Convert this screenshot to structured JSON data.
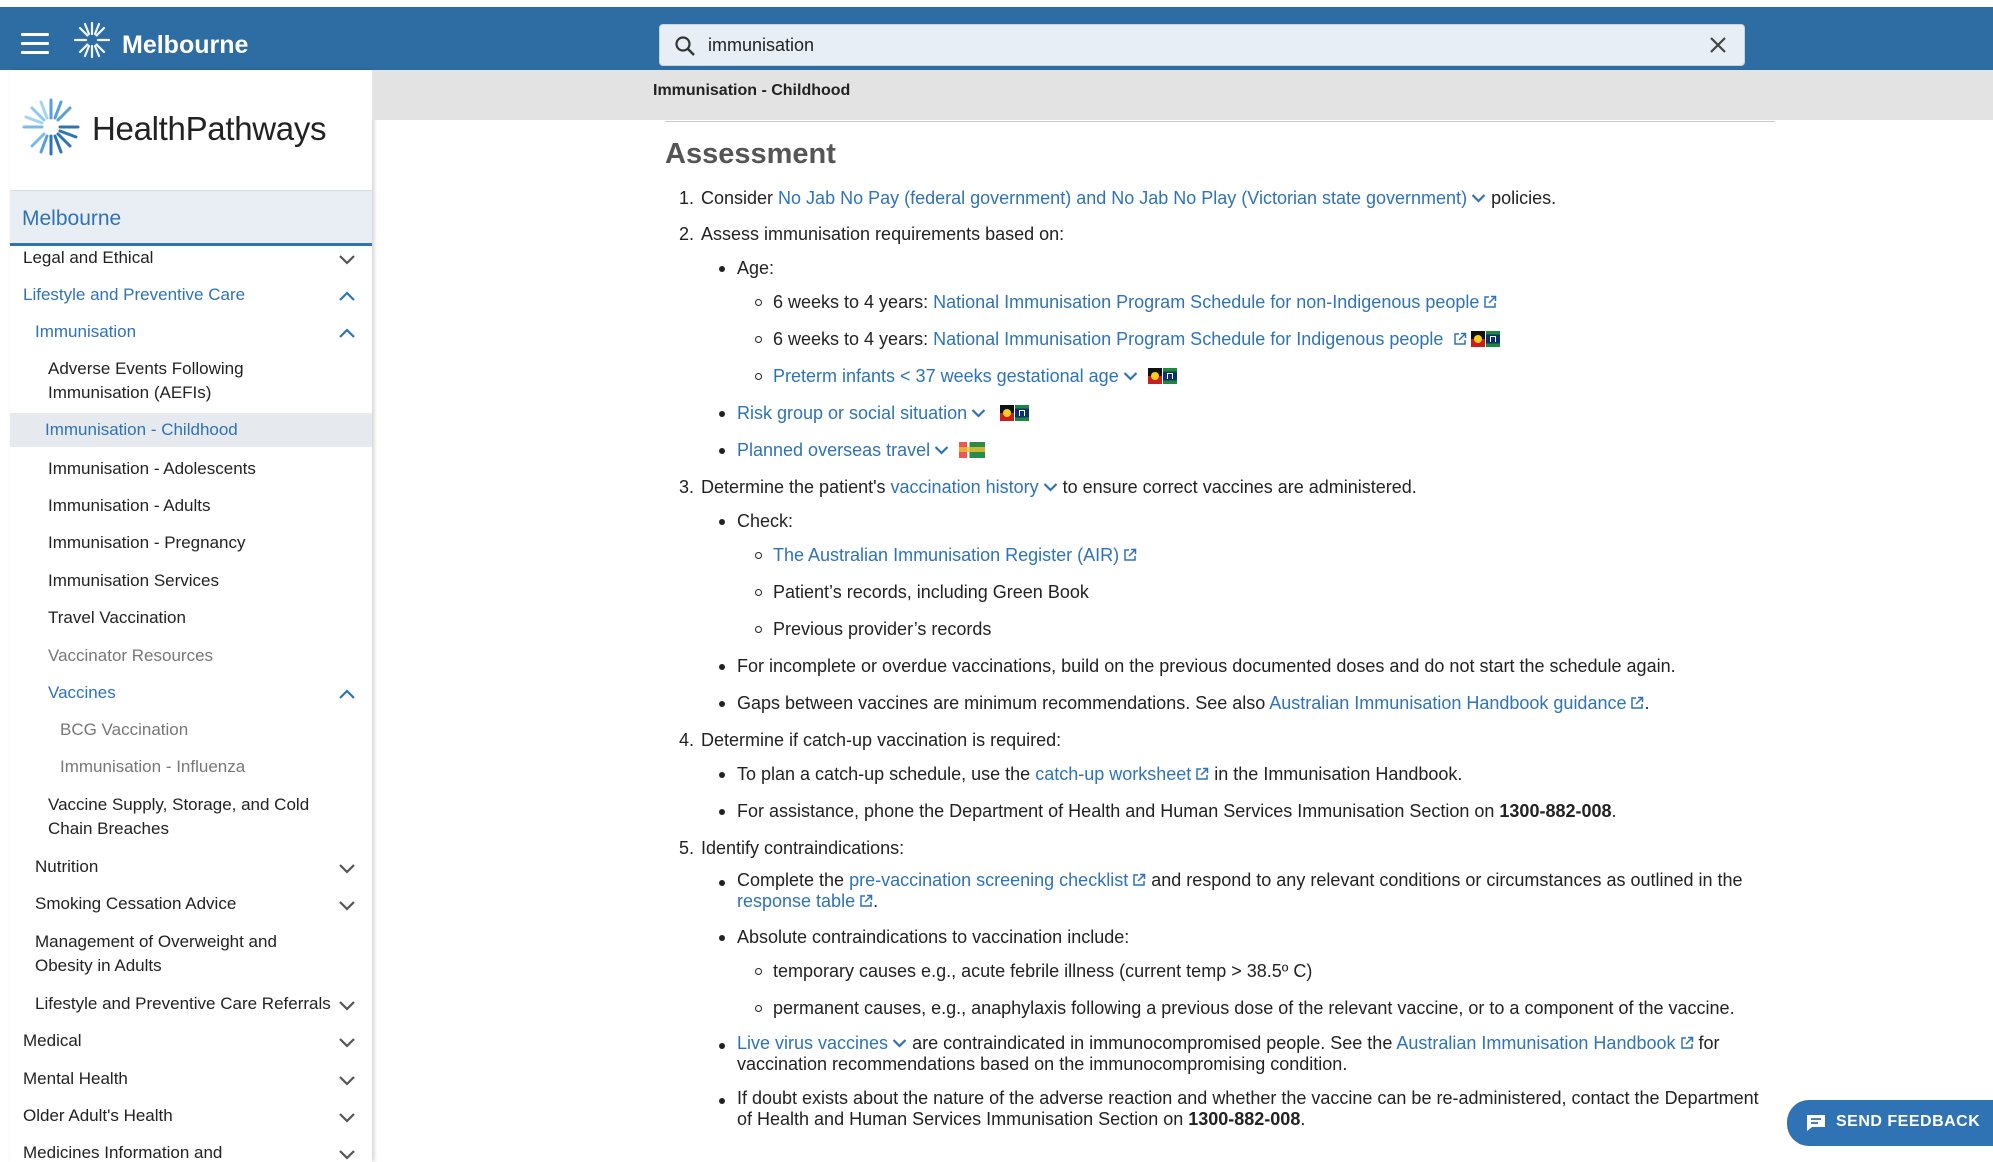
{
  "header": {
    "brand": "Melbourne",
    "search_value": "immunisation"
  },
  "sidebar": {
    "logo_text": "HealthPathways",
    "region": "Melbourne",
    "items": [
      {
        "label": "Legal and Ethical",
        "chevron": "down"
      },
      {
        "label": "Lifestyle and Preventive Care",
        "chevron": "up"
      },
      {
        "label": "Immunisation",
        "chevron": "up"
      },
      {
        "label": "Adverse Events Following Immunisation (AEFIs)"
      },
      {
        "label": "Immunisation - Childhood"
      },
      {
        "label": "Immunisation - Adolescents"
      },
      {
        "label": "Immunisation - Adults"
      },
      {
        "label": "Immunisation - Pregnancy"
      },
      {
        "label": "Immunisation Services"
      },
      {
        "label": "Travel Vaccination"
      },
      {
        "label": "Vaccinator Resources"
      },
      {
        "label": "Vaccines",
        "chevron": "up"
      },
      {
        "label": "BCG Vaccination"
      },
      {
        "label": "Immunisation - Influenza"
      },
      {
        "label": "Vaccine Supply, Storage, and Cold Chain Breaches"
      },
      {
        "label": "Nutrition",
        "chevron": "down"
      },
      {
        "label": "Smoking Cessation Advice",
        "chevron": "down"
      },
      {
        "label": "Management of Overweight and Obesity in Adults"
      },
      {
        "label": "Lifestyle and Preventive Care Referrals",
        "chevron": "down"
      },
      {
        "label": "Medical",
        "chevron": "down"
      },
      {
        "label": "Mental Health",
        "chevron": "down"
      },
      {
        "label": "Older Adult's Health",
        "chevron": "down"
      },
      {
        "label": "Medicines Information and Resources",
        "chevron": "down"
      }
    ]
  },
  "breadcrumb": "Immunisation - Childhood",
  "content": {
    "heading": "Assessment",
    "s1": {
      "num": "1.",
      "pre": "Consider ",
      "link": "No Jab No Pay (federal government) and No Jab No Play (Victorian state government)",
      "post": " policies."
    },
    "s2": {
      "num": "2.",
      "text": "Assess immunisation requirements based on:",
      "age": "Age:",
      "age_a_pre": "6 weeks to 4 years: ",
      "age_a_link": "National Immunisation Program Schedule for non-Indigenous people",
      "age_b_pre": "6 weeks to 4 years: ",
      "age_b_link": "National Immunisation Program Schedule for Indigenous people",
      "preterm": "Preterm infants < 37 weeks gestational age",
      "risk": "Risk group or social situation",
      "travel": "Planned overseas travel"
    },
    "s3": {
      "num": "3.",
      "pre": "Determine the patient's ",
      "link": "vaccination history",
      "post": " to ensure correct vaccines are administered.",
      "check": "Check:",
      "air": "The Australian Immunisation Register (AIR)",
      "records": "Patient’s records, including Green Book",
      "prev": "Previous provider’s records",
      "incomplete": "For incomplete or overdue vaccinations, build on the previous documented doses and do not start the schedule again.",
      "gaps_pre": "Gaps between vaccines are minimum recommendations. See also ",
      "gaps_link": "Australian Immunisation Handbook guidance",
      "gaps_post": "."
    },
    "s4": {
      "num": "4.",
      "text": "Determine if catch-up vaccination is required:",
      "plan_pre": "To plan a catch-up schedule, use the ",
      "plan_link": "catch-up worksheet",
      "plan_post": " in the Immunisation Handbook.",
      "assist_pre": "For assistance, phone the Department of Health and Human Services Immunisation Section on ",
      "assist_phone": "1300-882-008",
      "assist_post": "."
    },
    "s5": {
      "num": "5.",
      "text": "Identify contraindications:",
      "complete_pre": "Complete the ",
      "complete_link": "pre-vaccination screening checklist",
      "complete_mid": " and respond to any relevant conditions or circumstances as outlined in the ",
      "complete_link2": "response table",
      "complete_post": ".",
      "absolute": "Absolute contraindications to vaccination include:",
      "temporary": "temporary causes e.g., acute febrile illness (current temp > 38.5º C)",
      "permanent": "permanent causes, e.g., anaphylaxis following a previous dose of the relevant vaccine, or to a component of the vaccine.",
      "live_link": "Live virus vaccines",
      "live_mid": " are contraindicated in immunocompromised people. See the ",
      "live_link2": "Australian Immunisation Handbook",
      "live_post": " for vaccination recommendations based on the immunocompromising condition.",
      "doubt_pre": "If doubt exists about the nature of the adverse reaction and whether the vaccine can be re-administered, contact the Department of Health and Human Services Immunisation Section on ",
      "doubt_phone": "1300-882-008",
      "doubt_post": "."
    }
  },
  "feedback": {
    "label": "SEND FEEDBACK",
    "icon": "feedback-icon"
  }
}
